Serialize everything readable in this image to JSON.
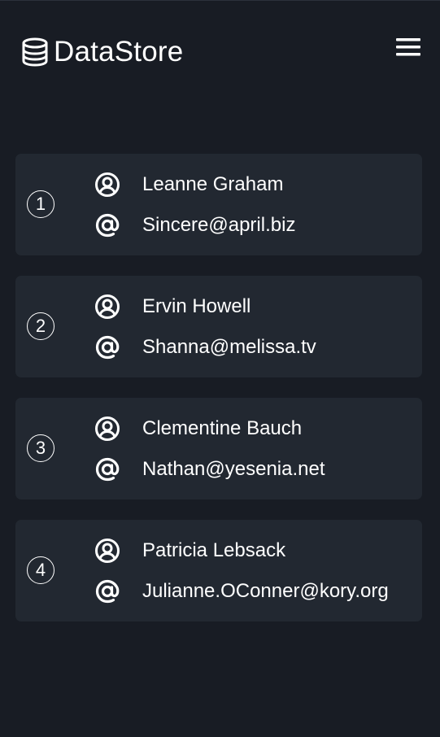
{
  "app": {
    "title": "DataStore",
    "logo_icon": "database-icon",
    "menu_icon": "hamburger-menu-icon"
  },
  "colors": {
    "background": "#181c24",
    "card": "#222831",
    "text": "#ffffff"
  },
  "users": [
    {
      "number": "1",
      "name": "Leanne Graham",
      "email": "Sincere@april.biz",
      "name_icon": "user-circle-icon",
      "email_icon": "at-sign-icon"
    },
    {
      "number": "2",
      "name": "Ervin Howell",
      "email": "Shanna@melissa.tv",
      "name_icon": "user-circle-icon",
      "email_icon": "at-sign-icon"
    },
    {
      "number": "3",
      "name": "Clementine Bauch",
      "email": "Nathan@yesenia.net",
      "name_icon": "user-circle-icon",
      "email_icon": "at-sign-icon"
    },
    {
      "number": "4",
      "name": "Patricia Lebsack",
      "email": "Julianne.OConner@kory.org",
      "name_icon": "user-circle-icon",
      "email_icon": "at-sign-icon"
    }
  ]
}
